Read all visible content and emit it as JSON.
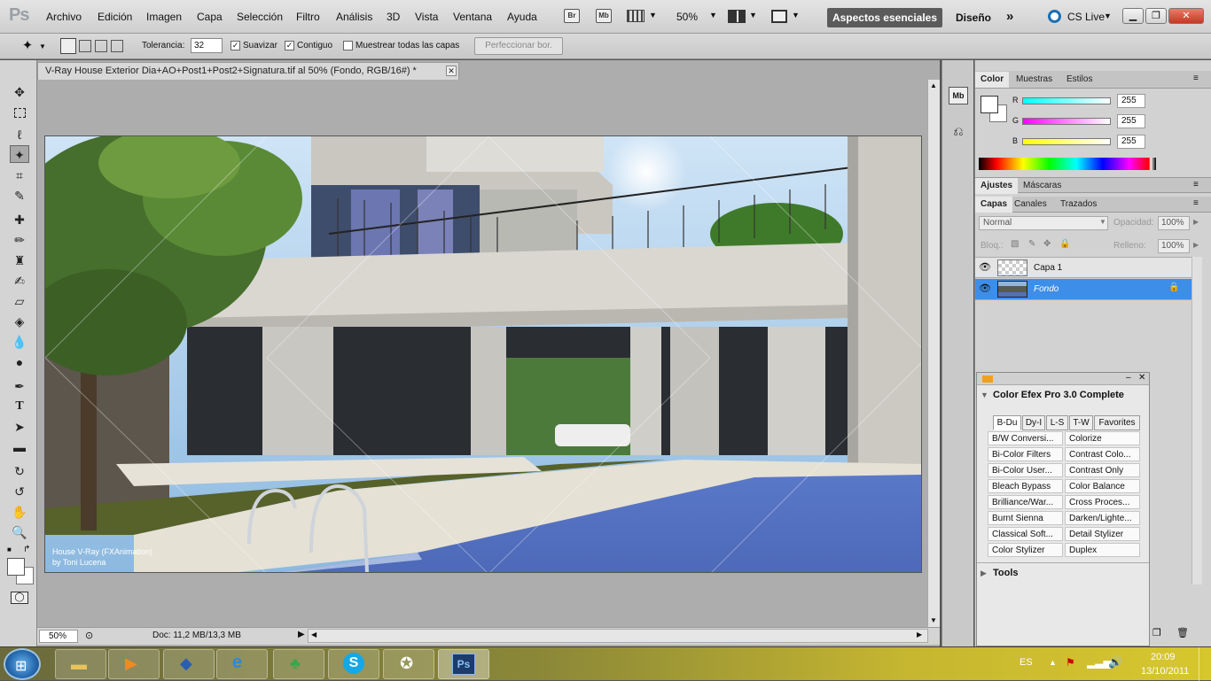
{
  "app": {
    "logo": "Ps"
  },
  "menu": [
    "Archivo",
    "Edición",
    "Imagen",
    "Capa",
    "Selección",
    "Filtro",
    "Análisis",
    "3D",
    "Vista",
    "Ventana",
    "Ayuda"
  ],
  "menubar_icons": {
    "bridge": "Br",
    "minibridge": "Mb"
  },
  "zoom_menu": "50%",
  "workspaces": {
    "active": "Aspectos esenciales",
    "other": "Diseño",
    "cslive": "CS Live"
  },
  "options": {
    "tolerance_label": "Tolerancia:",
    "tolerance_value": "32",
    "antialias_label": "Suavizar",
    "contiguous_label": "Contiguo",
    "sample_all_label": "Muestrear todas las capas",
    "refine_label": "Perfeccionar bor."
  },
  "document": {
    "tab_title": "V-Ray House Exterior Dia+AO+Post1+Post2+Signatura.tif al 50% (Fondo, RGB/16#) *",
    "watermark_line1": "House V-Ray (FXAnimation)",
    "watermark_line2": "by Toni Lucena",
    "status_zoom": "50%",
    "status_doc": "Doc: 11,2 MB/13,3 MB"
  },
  "color_panel": {
    "tabs": [
      "Color",
      "Muestras",
      "Estilos"
    ],
    "r_label": "R",
    "g_label": "G",
    "b_label": "B",
    "r": "255",
    "g": "255",
    "b": "255"
  },
  "adjust_panel": {
    "tabs": [
      "Ajustes",
      "Máscaras"
    ]
  },
  "layers_panel": {
    "tabs": [
      "Capas",
      "Canales",
      "Trazados"
    ],
    "blend_mode": "Normal",
    "opacity_label": "Opacidad:",
    "opacity": "100%",
    "lock_label": "Bloq.:",
    "fill_label": "Relleno:",
    "fill": "100%",
    "layers": [
      {
        "name": "Capa 1"
      },
      {
        "name": "Fondo"
      }
    ]
  },
  "efex": {
    "title": "Color Efex Pro 3.0 Complete",
    "tabs": [
      "B-Du",
      "Dy-I",
      "L-S",
      "T-W",
      "Favorites"
    ],
    "filters_left": [
      "B/W Conversi...",
      "Bi-Color Filters",
      "Bi-Color User...",
      "Bleach Bypass",
      "Brilliance/War...",
      "Burnt Sienna",
      "Classical Soft...",
      "Color Stylizer"
    ],
    "filters_right": [
      "Colorize",
      "Contrast Colo...",
      "Contrast Only",
      "Color Balance",
      "Cross Proces...",
      "Darken/Lighte...",
      "Detail Stylizer",
      "Duplex"
    ],
    "tools_label": "Tools"
  },
  "taskbar": {
    "language": "ES",
    "time": "20:09",
    "date": "13/10/2011"
  },
  "colors": {
    "selection_blue": "#3d8ee8",
    "accent_dark": "#5b5b5b"
  }
}
